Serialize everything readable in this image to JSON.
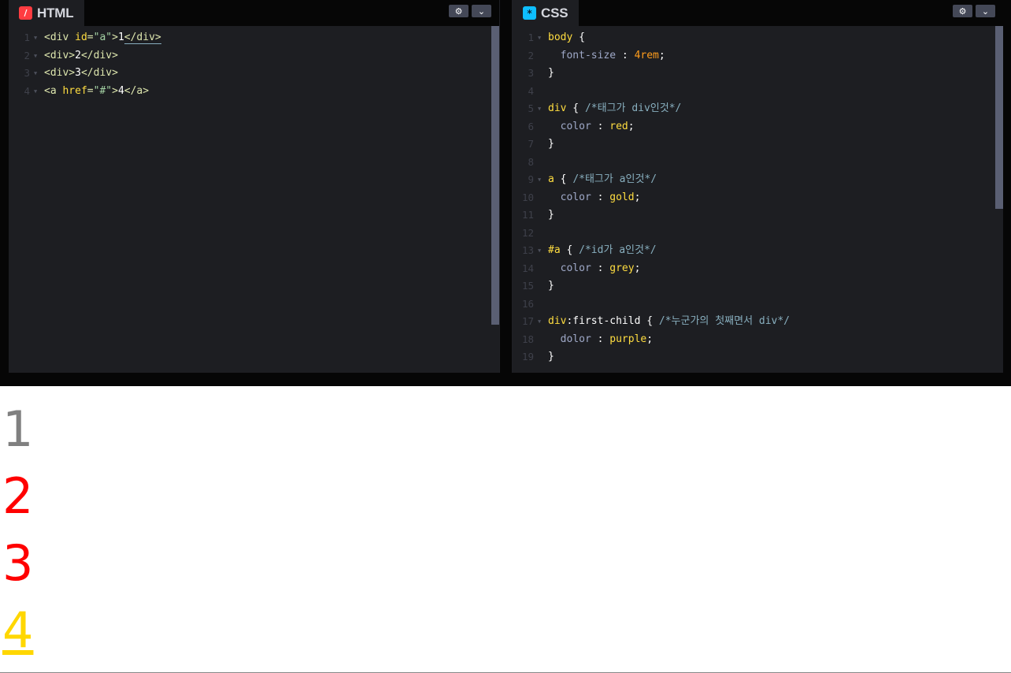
{
  "html_panel": {
    "tab_label": "HTML",
    "tab_icon": "codepen-html-icon",
    "lines": [
      {
        "n": "1",
        "parts": [
          [
            "tag",
            "<div "
          ],
          [
            "attr",
            "id"
          ],
          [
            "tag",
            "="
          ],
          [
            "str",
            "\"a\""
          ],
          [
            "tag",
            ">"
          ],
          [
            "pl",
            "1"
          ],
          [
            "tag",
            "</div>"
          ]
        ]
      },
      {
        "n": "2",
        "parts": [
          [
            "tag",
            "<div>"
          ],
          [
            "pl",
            "2"
          ],
          [
            "tag",
            "</div>"
          ]
        ]
      },
      {
        "n": "3",
        "parts": [
          [
            "tag",
            "<div>"
          ],
          [
            "pl",
            "3"
          ],
          [
            "tag",
            "</div>"
          ]
        ]
      },
      {
        "n": "4",
        "parts": [
          [
            "tag",
            "<a "
          ],
          [
            "attr",
            "href"
          ],
          [
            "tag",
            "="
          ],
          [
            "str",
            "\"#\""
          ],
          [
            "tag",
            ">"
          ],
          [
            "pl",
            "4"
          ],
          [
            "tag",
            "</a>"
          ]
        ]
      }
    ]
  },
  "css_panel": {
    "tab_label": "CSS",
    "tab_icon": "codepen-css-icon",
    "lines": [
      {
        "n": "1",
        "fold": true,
        "parts": [
          [
            "sel",
            "body"
          ],
          [
            "punc",
            " {"
          ]
        ]
      },
      {
        "n": "2",
        "parts": [
          [
            "prop",
            "  font-size "
          ],
          [
            "punc",
            ": "
          ],
          [
            "val-num",
            "4rem"
          ],
          [
            "punc",
            ";"
          ]
        ]
      },
      {
        "n": "3",
        "parts": [
          [
            "punc",
            "}"
          ]
        ]
      },
      {
        "n": "4",
        "parts": []
      },
      {
        "n": "5",
        "fold": true,
        "parts": [
          [
            "sel",
            "div"
          ],
          [
            "punc",
            " { "
          ],
          [
            "cmt",
            "/*태그가 div인것*/"
          ]
        ]
      },
      {
        "n": "6",
        "parts": [
          [
            "prop",
            "  color "
          ],
          [
            "punc",
            ": "
          ],
          [
            "val",
            "red"
          ],
          [
            "punc",
            ";"
          ]
        ]
      },
      {
        "n": "7",
        "parts": [
          [
            "punc",
            "}"
          ]
        ]
      },
      {
        "n": "8",
        "parts": []
      },
      {
        "n": "9",
        "fold": true,
        "parts": [
          [
            "sel",
            "a"
          ],
          [
            "punc",
            " { "
          ],
          [
            "cmt",
            "/*태그가 a인것*/"
          ]
        ]
      },
      {
        "n": "10",
        "parts": [
          [
            "prop",
            "  color "
          ],
          [
            "punc",
            ": "
          ],
          [
            "val",
            "gold"
          ],
          [
            "punc",
            ";"
          ]
        ]
      },
      {
        "n": "11",
        "parts": [
          [
            "punc",
            "}"
          ]
        ]
      },
      {
        "n": "12",
        "parts": []
      },
      {
        "n": "13",
        "fold": true,
        "parts": [
          [
            "sel",
            "#a"
          ],
          [
            "punc",
            " { "
          ],
          [
            "cmt",
            "/*id가 a인것*/"
          ]
        ]
      },
      {
        "n": "14",
        "parts": [
          [
            "prop",
            "  color "
          ],
          [
            "punc",
            ": "
          ],
          [
            "val",
            "grey"
          ],
          [
            "punc",
            ";"
          ]
        ]
      },
      {
        "n": "15",
        "parts": [
          [
            "punc",
            "}"
          ]
        ]
      },
      {
        "n": "16",
        "parts": []
      },
      {
        "n": "17",
        "fold": true,
        "parts": [
          [
            "sel",
            "div"
          ],
          [
            "pl",
            ":first-child"
          ],
          [
            "punc",
            " { "
          ],
          [
            "cmt",
            "/*누군가의 첫째면서 div*/"
          ]
        ]
      },
      {
        "n": "18",
        "parts": [
          [
            "prop",
            "  dolor "
          ],
          [
            "punc",
            ": "
          ],
          [
            "val",
            "purple"
          ],
          [
            "punc",
            ";"
          ]
        ]
      },
      {
        "n": "19",
        "parts": [
          [
            "punc",
            "}"
          ]
        ]
      }
    ]
  },
  "toolbar": {
    "settings_icon": "gear-icon",
    "collapse_icon": "chevron-down-icon"
  },
  "result": {
    "items": [
      {
        "text": "1",
        "color": "#808080"
      },
      {
        "text": "2",
        "color": "#ff0000"
      },
      {
        "text": "3",
        "color": "#ff0000"
      },
      {
        "text": "4",
        "color": "#ffd700",
        "underline": true
      }
    ]
  }
}
